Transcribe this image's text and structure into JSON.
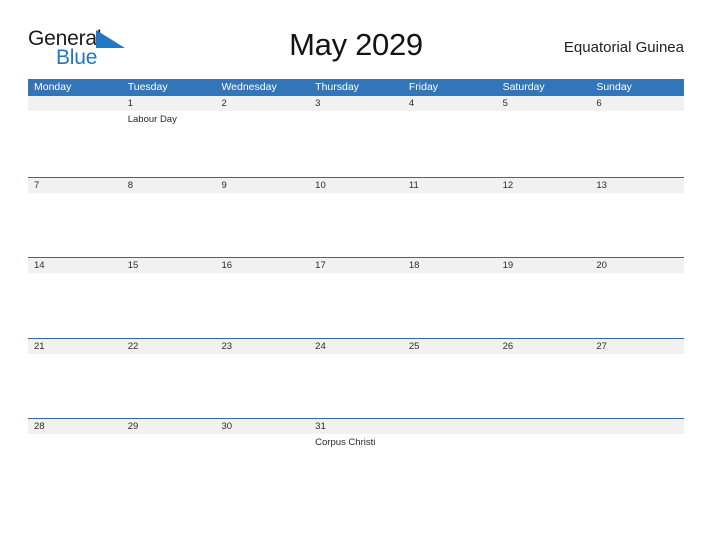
{
  "branding": {
    "logo_primary_text": "General",
    "logo_secondary_text": "Blue",
    "logo_icon": "blue-triangle-flag-icon",
    "primary_color": "#2277c4",
    "header_color": "#3275b8",
    "daynum_band_color": "#f1f1f1"
  },
  "header": {
    "title": "May 2029",
    "locale": "Equatorial Guinea"
  },
  "calendar": {
    "weekdays": [
      "Monday",
      "Tuesday",
      "Wednesday",
      "Thursday",
      "Friday",
      "Saturday",
      "Sunday"
    ],
    "weeks": [
      {
        "days": [
          {
            "num": "",
            "event": ""
          },
          {
            "num": "1",
            "event": "Labour Day"
          },
          {
            "num": "2",
            "event": ""
          },
          {
            "num": "3",
            "event": ""
          },
          {
            "num": "4",
            "event": ""
          },
          {
            "num": "5",
            "event": ""
          },
          {
            "num": "6",
            "event": ""
          }
        ]
      },
      {
        "days": [
          {
            "num": "7",
            "event": ""
          },
          {
            "num": "8",
            "event": ""
          },
          {
            "num": "9",
            "event": ""
          },
          {
            "num": "10",
            "event": ""
          },
          {
            "num": "11",
            "event": ""
          },
          {
            "num": "12",
            "event": ""
          },
          {
            "num": "13",
            "event": ""
          }
        ]
      },
      {
        "days": [
          {
            "num": "14",
            "event": ""
          },
          {
            "num": "15",
            "event": ""
          },
          {
            "num": "16",
            "event": ""
          },
          {
            "num": "17",
            "event": ""
          },
          {
            "num": "18",
            "event": ""
          },
          {
            "num": "19",
            "event": ""
          },
          {
            "num": "20",
            "event": ""
          }
        ]
      },
      {
        "days": [
          {
            "num": "21",
            "event": ""
          },
          {
            "num": "22",
            "event": ""
          },
          {
            "num": "23",
            "event": ""
          },
          {
            "num": "24",
            "event": ""
          },
          {
            "num": "25",
            "event": ""
          },
          {
            "num": "26",
            "event": ""
          },
          {
            "num": "27",
            "event": ""
          }
        ]
      },
      {
        "days": [
          {
            "num": "28",
            "event": ""
          },
          {
            "num": "29",
            "event": ""
          },
          {
            "num": "30",
            "event": ""
          },
          {
            "num": "31",
            "event": "Corpus Christi"
          },
          {
            "num": "",
            "event": ""
          },
          {
            "num": "",
            "event": ""
          },
          {
            "num": "",
            "event": ""
          }
        ]
      }
    ]
  }
}
